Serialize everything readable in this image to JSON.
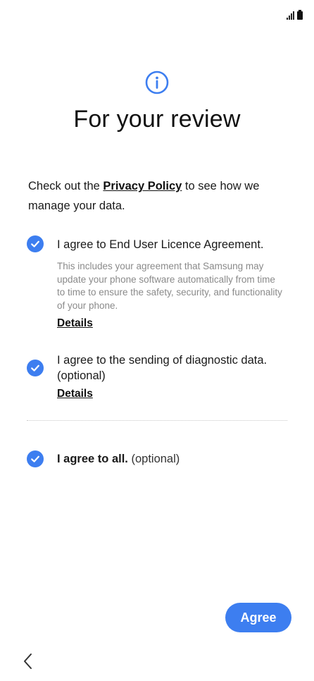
{
  "status_bar": {
    "icons": [
      "signal-icon",
      "battery-icon"
    ]
  },
  "header": {
    "icon": "info-icon",
    "title": "For your review"
  },
  "intro": {
    "prefix": "Check out the ",
    "link": "Privacy Policy",
    "suffix": " to see how we manage your data."
  },
  "items": [
    {
      "checked": true,
      "label": "I agree to End User Licence Agreement.",
      "description": "This includes your agreement that Samsung may update your phone software automatically from time to time to ensure the safety, security, and functionality of your phone.",
      "details_label": "Details"
    },
    {
      "checked": true,
      "label": "I agree to the sending of diagnostic data. (optional)",
      "details_label": "Details"
    }
  ],
  "agree_all": {
    "checked": true,
    "label": "I agree to all.",
    "optional": "(optional)"
  },
  "footer": {
    "agree_label": "Agree",
    "back_icon": "chevron-left-icon"
  },
  "colors": {
    "accent": "#3d7ef0",
    "text": "#1a1a1a",
    "muted": "#8a8a8a"
  }
}
